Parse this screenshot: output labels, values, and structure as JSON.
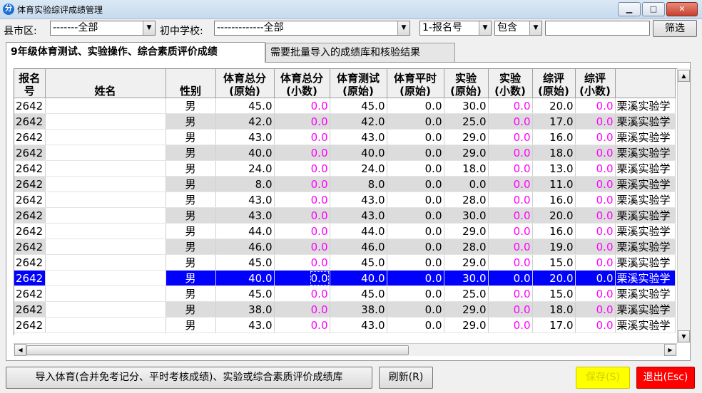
{
  "window": {
    "title": "体育实验综评成绩管理",
    "app_icon": "分",
    "btn_min": "▁",
    "btn_max": "□",
    "btn_close": "✕"
  },
  "filters": {
    "county_label": "县市区:",
    "county_value": "-------全部",
    "school_label": "初中学校:",
    "school_value": "-------------全部",
    "field_value": "1-报名号",
    "match_value": "包含",
    "search_value": "",
    "filter_button": "筛选"
  },
  "tabs": [
    {
      "label": "9年级体育测试、实验操作、综合素质评价成绩"
    },
    {
      "label": "需要批量导入的成绩库和核验结果"
    }
  ],
  "table": {
    "headers": [
      [
        "报名号"
      ],
      [
        "姓名"
      ],
      [
        "性别"
      ],
      [
        "体育总分",
        "(原始)"
      ],
      [
        "体育总分",
        "(小数)"
      ],
      [
        "体育测试",
        "(原始)"
      ],
      [
        "体育平时",
        "(原始)"
      ],
      [
        "实验",
        "(原始)"
      ],
      [
        "实验",
        "(小数)"
      ],
      [
        "综评",
        "(原始)"
      ],
      [
        "综评",
        "(小数)"
      ],
      [
        ""
      ]
    ],
    "rows": [
      [
        "2642",
        "",
        "男",
        "45.0",
        "0.0",
        "45.0",
        "0.0",
        "30.0",
        "0.0",
        "20.0",
        "0.0",
        "栗溪实验学"
      ],
      [
        "2642",
        "",
        "男",
        "42.0",
        "0.0",
        "42.0",
        "0.0",
        "25.0",
        "0.0",
        "17.0",
        "0.0",
        "栗溪实验学"
      ],
      [
        "2642",
        "",
        "男",
        "43.0",
        "0.0",
        "43.0",
        "0.0",
        "29.0",
        "0.0",
        "16.0",
        "0.0",
        "栗溪实验学"
      ],
      [
        "2642",
        "",
        "男",
        "40.0",
        "0.0",
        "40.0",
        "0.0",
        "29.0",
        "0.0",
        "18.0",
        "0.0",
        "栗溪实验学"
      ],
      [
        "2642",
        "",
        "男",
        "24.0",
        "0.0",
        "24.0",
        "0.0",
        "18.0",
        "0.0",
        "13.0",
        "0.0",
        "栗溪实验学"
      ],
      [
        "2642",
        "",
        "男",
        "8.0",
        "0.0",
        "8.0",
        "0.0",
        "0.0",
        "0.0",
        "11.0",
        "0.0",
        "栗溪实验学"
      ],
      [
        "2642",
        "",
        "男",
        "43.0",
        "0.0",
        "43.0",
        "0.0",
        "28.0",
        "0.0",
        "16.0",
        "0.0",
        "栗溪实验学"
      ],
      [
        "2642",
        "",
        "男",
        "43.0",
        "0.0",
        "43.0",
        "0.0",
        "30.0",
        "0.0",
        "20.0",
        "0.0",
        "栗溪实验学"
      ],
      [
        "2642",
        "",
        "男",
        "44.0",
        "0.0",
        "44.0",
        "0.0",
        "29.0",
        "0.0",
        "16.0",
        "0.0",
        "栗溪实验学"
      ],
      [
        "2642",
        "",
        "男",
        "46.0",
        "0.0",
        "46.0",
        "0.0",
        "28.0",
        "0.0",
        "19.0",
        "0.0",
        "栗溪实验学"
      ],
      [
        "2642",
        "",
        "男",
        "45.0",
        "0.0",
        "45.0",
        "0.0",
        "29.0",
        "0.0",
        "15.0",
        "0.0",
        "栗溪实验学"
      ],
      [
        "2642",
        "",
        "男",
        "40.0",
        "0.0",
        "40.0",
        "0.0",
        "30.0",
        "0.0",
        "20.0",
        "0.0",
        "栗溪实验学"
      ],
      [
        "2642",
        "",
        "男",
        "45.0",
        "0.0",
        "45.0",
        "0.0",
        "25.0",
        "0.0",
        "15.0",
        "0.0",
        "栗溪实验学"
      ],
      [
        "2642",
        "",
        "男",
        "38.0",
        "0.0",
        "38.0",
        "0.0",
        "29.0",
        "0.0",
        "18.0",
        "0.0",
        "栗溪实验学"
      ],
      [
        "2642",
        "",
        "男",
        "43.0",
        "0.0",
        "43.0",
        "0.0",
        "29.0",
        "0.0",
        "17.0",
        "0.0",
        "栗溪实验学"
      ]
    ],
    "selected_row": 11
  },
  "footer": {
    "import_button": "导入体育(合并免考记分、平时考核成绩)、实验或综合素质评价成绩库",
    "refresh_button": "刷新(R)",
    "save_button": "保存(S)",
    "exit_button": "退出(Esc)"
  },
  "colors": {
    "decimal_text": "#ff00ff",
    "selected_row": "#0000ff",
    "save_bg": "#ffff00",
    "exit_bg": "#ff0000"
  }
}
